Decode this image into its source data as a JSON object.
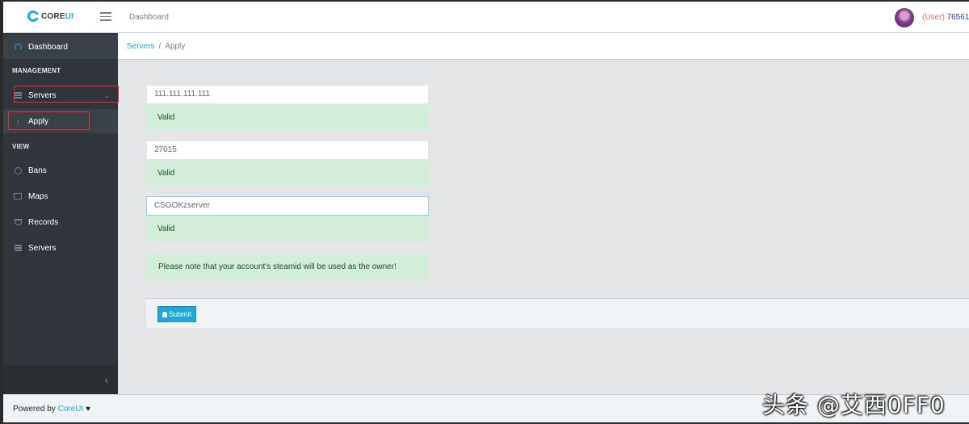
{
  "header": {
    "brand_core": "CORE",
    "brand_ui": "UI",
    "nav_dashboard": "Dashboard",
    "user_role": "(User)",
    "user_id": "76561"
  },
  "sidebar": {
    "dashboard": "Dashboard",
    "section_management": "MANAGEMENT",
    "servers_group": "Servers",
    "apply": "Apply",
    "section_view": "VIEW",
    "bans": "Bans",
    "maps": "Maps",
    "records": "Records",
    "servers": "Servers",
    "minimizer_glyph": "‹"
  },
  "breadcrumb": {
    "parent": "Servers",
    "separator": "/",
    "current": "Apply"
  },
  "form": {
    "ip_value": "111.111.111.111",
    "ip_status": "Valid",
    "port_value": "27015",
    "port_status": "Valid",
    "name_value": "CSGOKzserver",
    "name_status": "Valid",
    "note": "Please note that your account's steamid will be used as the owner!",
    "submit_label": "Submit"
  },
  "footer": {
    "prefix": "Powered by",
    "link": "CoreUI",
    "heart": "♥"
  },
  "watermark": "头条 @艾西0FF0",
  "colors": {
    "accent": "#20a8d8",
    "sidebar_bg": "#2f353a",
    "valid_bg": "#d4edda",
    "valid_text": "#155724",
    "highlight_box": "#e03030"
  }
}
